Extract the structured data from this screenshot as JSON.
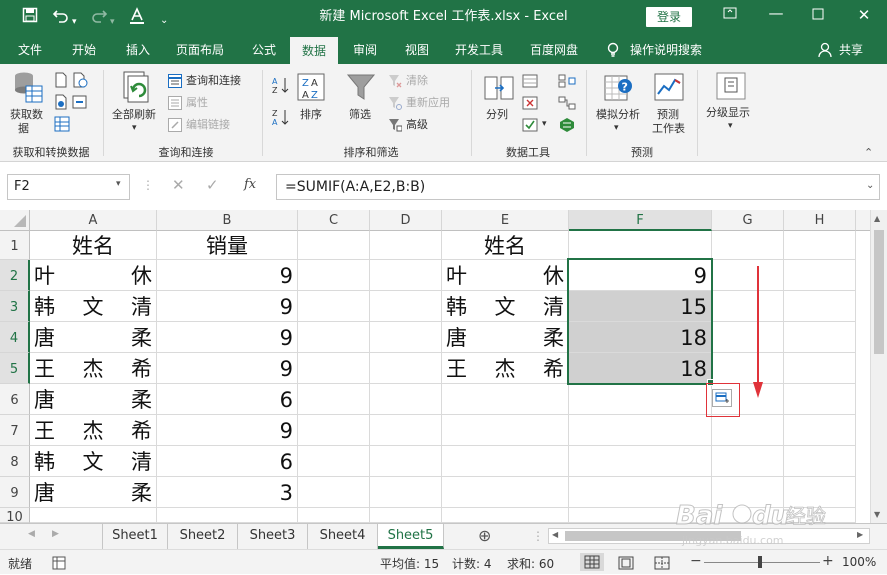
{
  "titlebar": {
    "title": "新建 Microsoft Excel 工作表.xlsx  -  Excel",
    "login": "登录"
  },
  "tabs": [
    "文件",
    "开始",
    "插入",
    "页面布局",
    "公式",
    "数据",
    "审阅",
    "视图",
    "开发工具",
    "百度网盘",
    "操作说明搜索"
  ],
  "active_tab": "数据",
  "share": "共享",
  "ribbon": {
    "get_data": "获取数\n据",
    "get_data_l1": "获取数",
    "get_data_l2": "据",
    "group_get": "获取和转换数据",
    "refresh_all": "全部刷新",
    "query_conn": "查询和连接",
    "properties": "属性",
    "edit_links": "编辑链接",
    "group_query": "查询和连接",
    "sort": "排序",
    "filter": "筛选",
    "clear": "清除",
    "reapply": "重新应用",
    "advanced": "高级",
    "group_sort": "排序和筛选",
    "split": "分列",
    "group_tools": "数据工具",
    "whatif": "模拟分析",
    "forecast_l1": "预测",
    "forecast_l2": "工作表",
    "group_forecast": "预测",
    "outline": "分级显示"
  },
  "formula_bar": {
    "name_box": "F2",
    "fx": "fx",
    "formula": "=SUMIF(A:A,E2,B:B)"
  },
  "columns": [
    "A",
    "B",
    "C",
    "D",
    "E",
    "F",
    "G",
    "H"
  ],
  "rows": [
    "1",
    "2",
    "3",
    "4",
    "5",
    "6",
    "7",
    "8",
    "9",
    "10"
  ],
  "sheet": {
    "A1": "姓名",
    "B1": "销量",
    "E1": "姓名",
    "left_names": [
      [
        "叶",
        "休"
      ],
      [
        "韩",
        "文",
        "清"
      ],
      [
        "唐",
        "柔"
      ],
      [
        "王",
        "杰",
        "希"
      ],
      [
        "唐",
        "柔"
      ],
      [
        "王",
        "杰",
        "希"
      ],
      [
        "韩",
        "文",
        "清"
      ],
      [
        "唐",
        "柔"
      ]
    ],
    "sales": [
      "9",
      "9",
      "9",
      "9",
      "6",
      "9",
      "6",
      "3"
    ],
    "right_names": [
      [
        "叶",
        "休"
      ],
      [
        "韩",
        "文",
        "清"
      ],
      [
        "唐",
        "柔"
      ],
      [
        "王",
        "杰",
        "希"
      ]
    ],
    "sumif": [
      "9",
      "15",
      "18",
      "18"
    ]
  },
  "sheet_tabs": [
    "Sheet1",
    "Sheet2",
    "Sheet3",
    "Sheet4",
    "Sheet5"
  ],
  "active_sheet": "Sheet5",
  "status": {
    "ready": "就绪",
    "average": "平均值: 15",
    "count": "计数: 4",
    "sum": "求和: 60",
    "zoom": "100%"
  },
  "watermark": "Baidu经验 jingyan.baidu.com",
  "colors": {
    "accent": "#217346",
    "arrow": "#e0333a"
  }
}
